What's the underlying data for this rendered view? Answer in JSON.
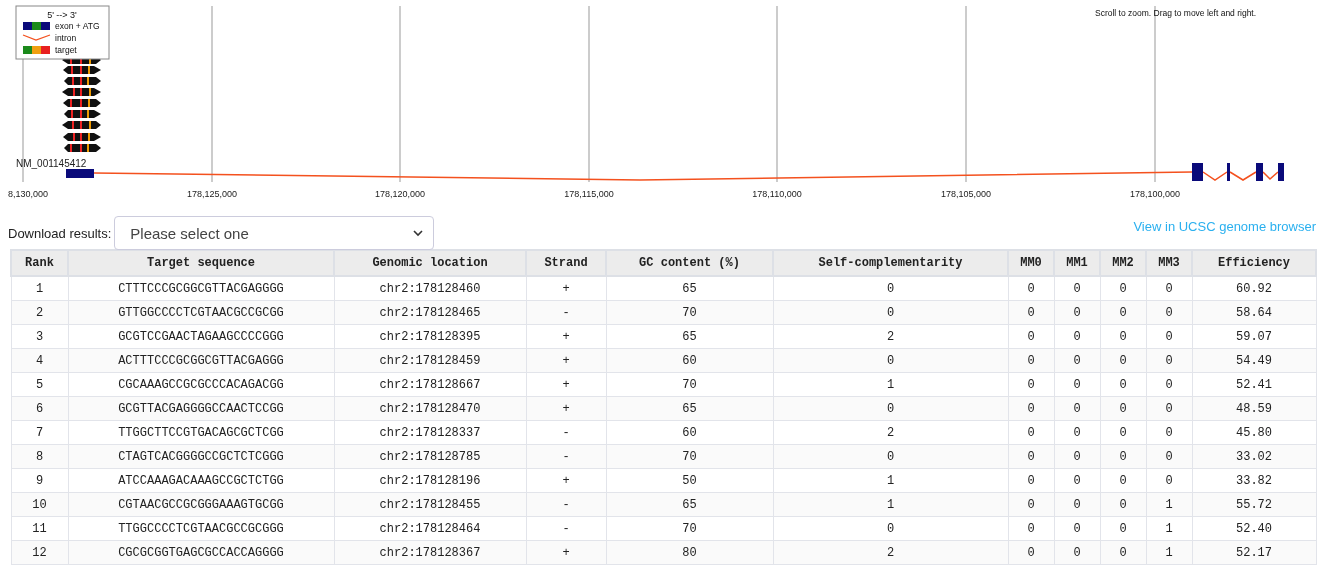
{
  "track": {
    "legend": {
      "title": "5' --> 3'",
      "items": [
        {
          "kind": "exon",
          "label": "exon + ATG"
        },
        {
          "kind": "intron",
          "label": "intron"
        },
        {
          "kind": "target",
          "label": "target"
        }
      ]
    },
    "hint": "Scroll to zoom. Drag to move left and right.",
    "gene": "NM_001145412",
    "axis_ticks": [
      "8,130,000",
      "178,125,000",
      "178,120,000",
      "178,115,000",
      "178,110,000",
      "178,105,000",
      "178,100,000"
    ]
  },
  "download": {
    "label": "Download results:",
    "placeholder": "Please select one"
  },
  "ucsc_link": "View in UCSC genome browser",
  "table": {
    "columns": [
      "Rank",
      "Target sequence",
      "Genomic location",
      "Strand",
      "GC content (%)",
      "Self-complementarity",
      "MM0",
      "MM1",
      "MM2",
      "MM3",
      "Efficiency"
    ],
    "rows": [
      [
        "1",
        "CTTTCCCGCGGCGTTACGAGGGG",
        "chr2:178128460",
        "+",
        "65",
        "0",
        "0",
        "0",
        "0",
        "0",
        "60.92"
      ],
      [
        "2",
        "GTTGGCCCCTCGTAACGCCGCGG",
        "chr2:178128465",
        "-",
        "70",
        "0",
        "0",
        "0",
        "0",
        "0",
        "58.64"
      ],
      [
        "3",
        "GCGTCCGAACTAGAAGCCCCGGG",
        "chr2:178128395",
        "+",
        "65",
        "2",
        "0",
        "0",
        "0",
        "0",
        "59.07"
      ],
      [
        "4",
        "ACTTTCCCGCGGCGTTACGAGGG",
        "chr2:178128459",
        "+",
        "60",
        "0",
        "0",
        "0",
        "0",
        "0",
        "54.49"
      ],
      [
        "5",
        "CGCAAAGCCGCGCCCACAGACGG",
        "chr2:178128667",
        "+",
        "70",
        "1",
        "0",
        "0",
        "0",
        "0",
        "52.41"
      ],
      [
        "6",
        "GCGTTACGAGGGGCCAACTCCGG",
        "chr2:178128470",
        "+",
        "65",
        "0",
        "0",
        "0",
        "0",
        "0",
        "48.59"
      ],
      [
        "7",
        "TTGGCTTCCGTGACAGCGCTCGG",
        "chr2:178128337",
        "-",
        "60",
        "2",
        "0",
        "0",
        "0",
        "0",
        "45.80"
      ],
      [
        "8",
        "CTAGTCACGGGGCCGCTCTCGGG",
        "chr2:178128785",
        "-",
        "70",
        "0",
        "0",
        "0",
        "0",
        "0",
        "33.02"
      ],
      [
        "9",
        "ATCCAAAGACAAAGCCGCTCTGG",
        "chr2:178128196",
        "+",
        "50",
        "1",
        "0",
        "0",
        "0",
        "0",
        "33.82"
      ],
      [
        "10",
        "CGTAACGCCGCGGGAAAGTGCGG",
        "chr2:178128455",
        "-",
        "65",
        "1",
        "0",
        "0",
        "0",
        "1",
        "55.72"
      ],
      [
        "11",
        "TTGGCCCCTCGTAACGCCGCGGG",
        "chr2:178128464",
        "-",
        "70",
        "0",
        "0",
        "0",
        "0",
        "1",
        "52.40"
      ],
      [
        "12",
        "CGCGCGGTGAGCGCCACCAGGGG",
        "chr2:178128367",
        "+",
        "80",
        "2",
        "0",
        "0",
        "0",
        "1",
        "52.17"
      ]
    ]
  }
}
